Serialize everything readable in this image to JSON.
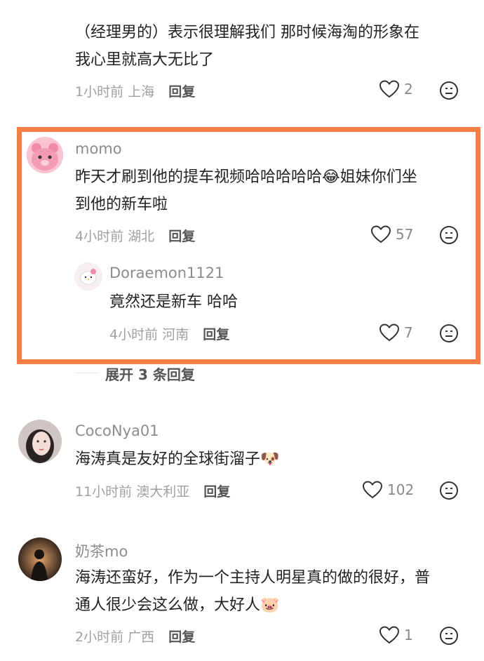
{
  "comments": [
    {
      "text_lines": [
        "（经理男的）表示很理解我们 那时候海淘的形象在",
        "我心里就高大无比了"
      ],
      "time": "1小时前",
      "location": "上海",
      "reply_label": "回复",
      "likes": "2"
    },
    {
      "username": "momo",
      "text_lines": [
        "昨天才刷到他的提车视频哈哈哈哈哈😂姐妹你们坐",
        "到他的新车啦"
      ],
      "time": "4小时前",
      "location": "湖北",
      "reply_label": "回复",
      "likes": "57",
      "sub_reply": {
        "username": "Doraemon1121",
        "text": "竟然还是新车 哈哈",
        "time": "4小时前",
        "location": "河南",
        "reply_label": "回复",
        "likes": "7"
      },
      "expand_label": "展开 3 条回复"
    },
    {
      "username": "CocoNya01",
      "text_lines": [
        "海涛真是友好的全球街溜子🐶"
      ],
      "time": "11小时前",
      "location": "澳大利亚",
      "reply_label": "回复",
      "likes": "102"
    },
    {
      "username": "奶茶mo",
      "text_lines": [
        "海涛还蛮好，作为一个主持人明星真的做的很好，普",
        "通人很少会这么做，大好人🐷"
      ],
      "time": "2小时前",
      "location": "广西",
      "reply_label": "回复",
      "likes": "1"
    }
  ],
  "colors": {
    "highlight_border": "#f47e45",
    "meta_gray": "#a0a0a0"
  },
  "icons": {
    "like": "heart-outline-icon",
    "dislike": "neutral-face-icon"
  }
}
